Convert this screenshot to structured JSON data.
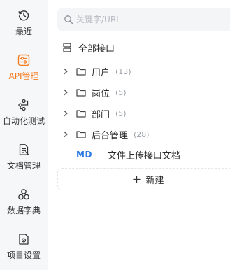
{
  "nav": {
    "items": [
      {
        "label": "最近",
        "icon": "history-icon"
      },
      {
        "label": "API管理",
        "icon": "api-management-icon",
        "active": true
      },
      {
        "label": "自动化测试",
        "icon": "automation-test-icon"
      },
      {
        "label": "文档管理",
        "icon": "document-icon"
      },
      {
        "label": "数据字典",
        "icon": "data-dictionary-icon"
      },
      {
        "label": "项目设置",
        "icon": "project-settings-icon"
      }
    ]
  },
  "search": {
    "placeholder": "关键字/URL"
  },
  "tree": {
    "root_label": "全部接口",
    "folders": [
      {
        "label": "用户",
        "count": "(13)"
      },
      {
        "label": "岗位",
        "count": "(5)"
      },
      {
        "label": "部门",
        "count": "(5)"
      },
      {
        "label": "后台管理",
        "count": "(28)"
      }
    ],
    "doc": {
      "badge": "MD",
      "label": "文件上传接口文档"
    }
  },
  "new_button": {
    "label": "新建"
  },
  "colors": {
    "accent": "#f57c1f",
    "md_badge": "#2d7be5",
    "rail_bg": "#f6f7f9",
    "count_gray": "#9aa0a8"
  }
}
